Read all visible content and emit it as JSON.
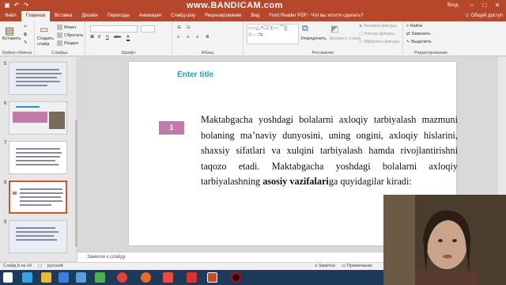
{
  "watermark": "www.BANDICAM.com",
  "ribbon_tabs": [
    "Файл",
    "Главная",
    "Вставка",
    "Дизайн",
    "Переходы",
    "Анимация",
    "Слайд-шоу",
    "Рецензирование",
    "Вид",
    "Foxit Reader PDF"
  ],
  "tell_me": "Что вы хотите сделать?",
  "signin": "Вход",
  "share": "Общий доступ",
  "groups": {
    "clipboard": {
      "paste": "Вставить",
      "label": "Буфер обмена"
    },
    "slides": {
      "create": "Создать слайд",
      "layout": "Макет",
      "reset": "Сбросить",
      "section": "Раздел",
      "label": "Слайды"
    },
    "font": {
      "label": "Шрифт"
    },
    "paragraph": {
      "label": "Абзац"
    },
    "drawing": {
      "arrange": "Упорядочить",
      "styles": "Экспресс-стили",
      "fill": "Заливка фигуры",
      "outline": "Контур фигуры",
      "effects": "Эффекты фигуры",
      "label": "Рисование"
    },
    "editing": {
      "find": "Найти",
      "replace": "Заменить",
      "select": "Выделить",
      "label": "Редактирование"
    }
  },
  "thumbnails": [
    {
      "num": "5"
    },
    {
      "num": "6"
    },
    {
      "num": "7"
    },
    {
      "num": "8"
    },
    {
      "num": "9"
    }
  ],
  "slide": {
    "title": "Enter title",
    "number": "1",
    "body_pre": "Maktabgacha yoshdagi bolalarni axloqiy tarbiyalash mazmuni bolaning ma’naviy dunyosini, uning ongini, axloqiy hislarini, shaxsiy sifatlari va xulqini tarbiyalash hamda rivojlantirishni taqozo etadi. Maktabgacha yoshdagi bolalarni axloqiy tarbiyalashning ",
    "body_bold": "asosiy vazifalari",
    "body_post": "ga quyidagilar kiradi:"
  },
  "notes_placeholder": "Заметки к слайду",
  "status": {
    "slide": "Слайд 8 из 14",
    "lang": "русский",
    "notes": "Заметки",
    "comments": "Примечания"
  },
  "colors": {
    "accent": "#b7472a",
    "title": "#1fa3c9",
    "numbox": "#c17ba8"
  }
}
